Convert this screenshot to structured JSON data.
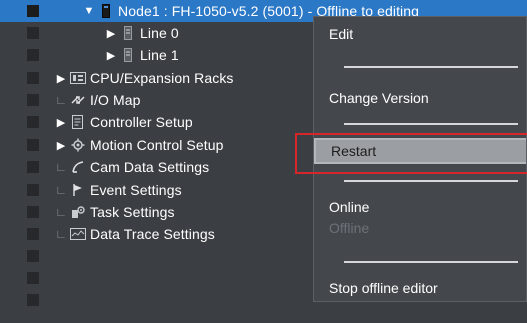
{
  "tree": {
    "rows": [
      {
        "label": "Node1 : FH-1050-v5.2 (5001) - Offline to editing",
        "icon": "controller-device-icon",
        "arrow": "▼"
      },
      {
        "label": "Line 0",
        "icon": "line-icon",
        "arrow": "▶"
      },
      {
        "label": "Line 1",
        "icon": "line-icon",
        "arrow": "▶"
      },
      {
        "label": "CPU/Expansion Racks",
        "icon": "rack-icon",
        "arrow": "▶"
      },
      {
        "label": "I/O Map",
        "icon": "io-map-icon",
        "arrow": ""
      },
      {
        "label": "Controller Setup",
        "icon": "controller-setup-icon",
        "arrow": "▶"
      },
      {
        "label": "Motion Control Setup",
        "icon": "gear-icon",
        "arrow": "▶"
      },
      {
        "label": "Cam Data Settings",
        "icon": "cam-icon",
        "arrow": ""
      },
      {
        "label": "Event Settings",
        "icon": "flag-icon",
        "arrow": ""
      },
      {
        "label": "Task Settings",
        "icon": "task-icon",
        "arrow": ""
      },
      {
        "label": "Data Trace Settings",
        "icon": "trace-icon",
        "arrow": ""
      }
    ]
  },
  "context_menu": {
    "edit": "Edit",
    "change_version": "Change Version",
    "restart": "Restart",
    "online": "Online",
    "offline": "Offline",
    "stop_offline_editor": "Stop offline editor"
  },
  "colors": {
    "background": "#3b3e42",
    "selected_row": "#2b78c7",
    "menu_background": "#44484d",
    "highlight_outline": "#d6262a"
  }
}
